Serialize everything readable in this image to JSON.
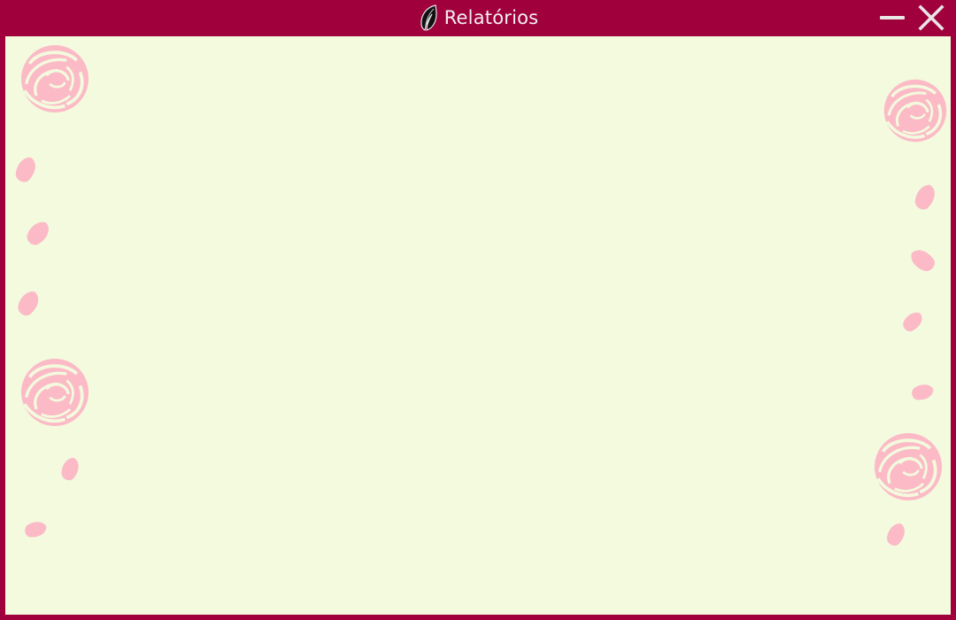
{
  "window": {
    "title": "Relatórios",
    "app_icon": "feather-leaf-icon",
    "controls": {
      "minimize_icon": "minimize-icon",
      "close_icon": "close-icon"
    }
  },
  "colors": {
    "frame": "#a0003c",
    "content_background": "#f3fade",
    "decoration": "#fbbac6",
    "title_text": "#f3f0f0"
  }
}
